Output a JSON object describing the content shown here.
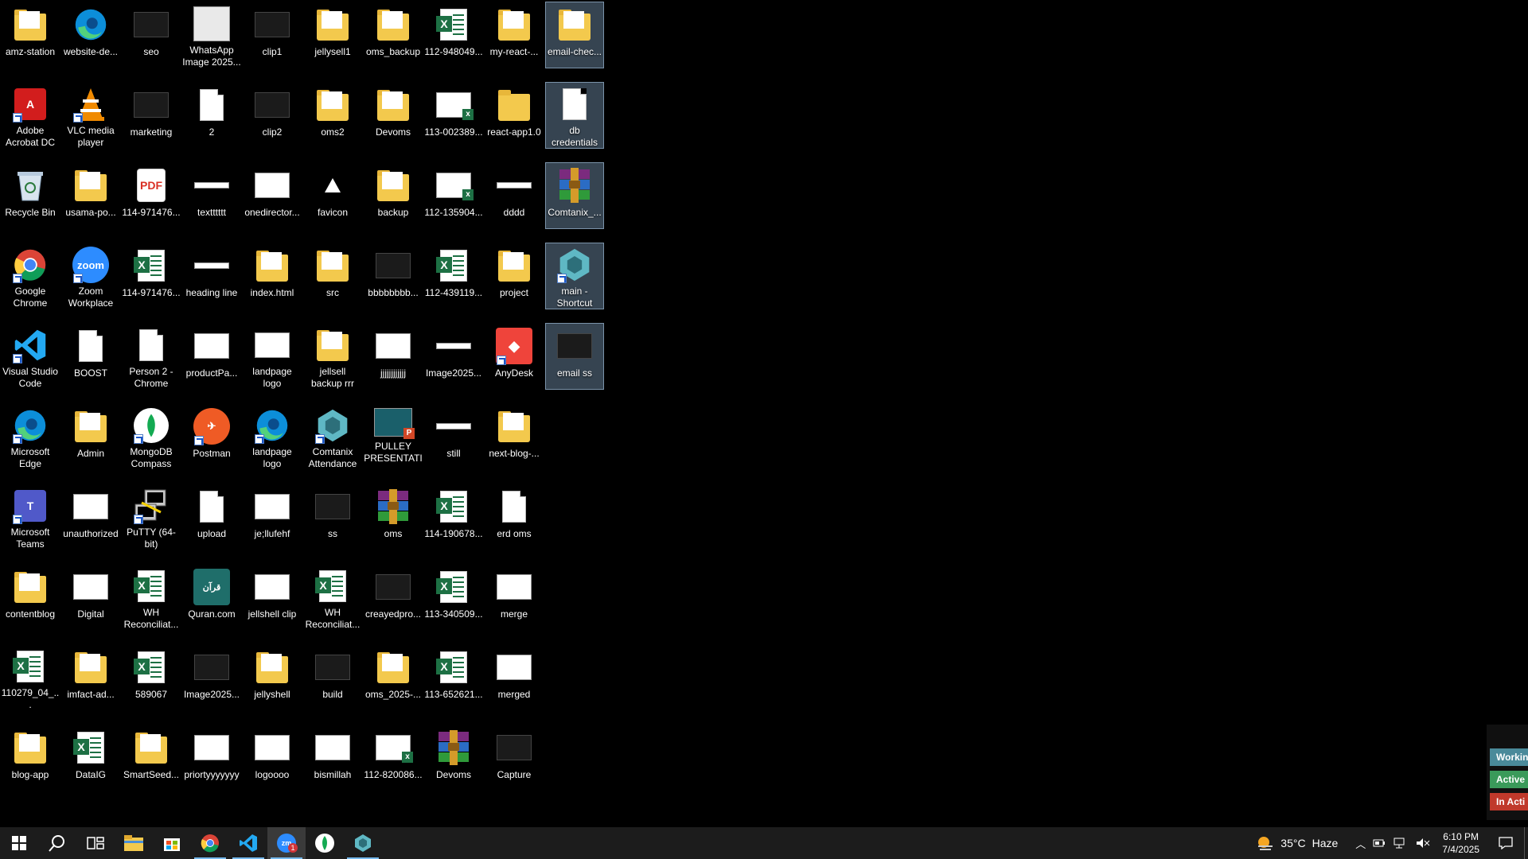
{
  "desktop": {
    "icons": [
      {
        "label": "amz-station",
        "type": "folder"
      },
      {
        "label": "Adobe Acrobat DC",
        "type": "acrobat",
        "shortcut": true
      },
      {
        "label": "Recycle Bin",
        "type": "recycle"
      },
      {
        "label": "Google Chrome",
        "type": "chrome",
        "shortcut": true
      },
      {
        "label": "Visual Studio Code",
        "type": "vscode",
        "shortcut": true
      },
      {
        "label": "Microsoft Edge",
        "type": "edge",
        "shortcut": true
      },
      {
        "label": "Microsoft Teams",
        "type": "teams",
        "shortcut": true
      },
      {
        "label": "contentblog",
        "type": "folder"
      },
      {
        "label": "110279_04_...",
        "type": "excel"
      },
      {
        "label": "blog-app",
        "type": "folder"
      },
      {
        "label": "website-de...",
        "type": "edge"
      },
      {
        "label": "VLC media player",
        "type": "vlc",
        "shortcut": true
      },
      {
        "label": "usama-po...",
        "type": "folder"
      },
      {
        "label": "Zoom Workplace",
        "type": "zoom",
        "shortcut": true
      },
      {
        "label": "BOOST",
        "type": "doc"
      },
      {
        "label": "Admin",
        "type": "folder"
      },
      {
        "label": "unauthorized",
        "type": "thumb"
      },
      {
        "label": "Digital",
        "type": "thumb"
      },
      {
        "label": "imfact-ad...",
        "type": "folder"
      },
      {
        "label": "DataIG",
        "type": "excel"
      },
      {
        "label": "seo",
        "type": "thumb-dark"
      },
      {
        "label": "marketing",
        "type": "thumb-dark"
      },
      {
        "label": "114-971476...",
        "type": "pdf"
      },
      {
        "label": "114-971476...",
        "type": "excel"
      },
      {
        "label": "Person 2 - Chrome",
        "type": "doc"
      },
      {
        "label": "MongoDB Compass",
        "type": "mongo",
        "shortcut": true
      },
      {
        "label": "PuTTY (64-bit)",
        "type": "putty",
        "shortcut": true
      },
      {
        "label": "WH Reconciliat...",
        "type": "excel"
      },
      {
        "label": "589067",
        "type": "excel"
      },
      {
        "label": "SmartSeed...",
        "type": "folder"
      },
      {
        "label": "WhatsApp Image 2025...",
        "type": "thumb-gray"
      },
      {
        "label": "2",
        "type": "doc"
      },
      {
        "label": "textttttt",
        "type": "bar"
      },
      {
        "label": "heading line",
        "type": "bar"
      },
      {
        "label": "productPa...",
        "type": "thumb"
      },
      {
        "label": "Postman",
        "type": "postman",
        "shortcut": true
      },
      {
        "label": "upload",
        "type": "doc"
      },
      {
        "label": "Quran.com",
        "type": "quran"
      },
      {
        "label": "Image2025...",
        "type": "thumb-dark"
      },
      {
        "label": "priortyyyyyyy",
        "type": "thumb"
      },
      {
        "label": "clip1",
        "type": "thumb-dark"
      },
      {
        "label": "clip2",
        "type": "thumb-dark"
      },
      {
        "label": "onedirector...",
        "type": "thumb"
      },
      {
        "label": "index.html",
        "type": "folder"
      },
      {
        "label": "landpage logo",
        "type": "thumb"
      },
      {
        "label": "landpage logo",
        "type": "edge",
        "shortcut": true
      },
      {
        "label": "je;llufehf",
        "type": "thumb"
      },
      {
        "label": "jellshell clip",
        "type": "thumb"
      },
      {
        "label": "jellyshell",
        "type": "folder"
      },
      {
        "label": "logoooo",
        "type": "thumb"
      },
      {
        "label": "jellysell1",
        "type": "folder"
      },
      {
        "label": "oms2",
        "type": "folder"
      },
      {
        "label": "favicon",
        "type": "triangle"
      },
      {
        "label": "src",
        "type": "folder"
      },
      {
        "label": "jellsell backup rrr",
        "type": "folder"
      },
      {
        "label": "Comtanix Attendance",
        "type": "comtanix",
        "shortcut": true
      },
      {
        "label": "ss",
        "type": "thumb-dark"
      },
      {
        "label": "WH Reconciliat...",
        "type": "excel"
      },
      {
        "label": "build",
        "type": "thumb-dark"
      },
      {
        "label": "bismillah",
        "type": "thumb"
      },
      {
        "label": "oms_backup",
        "type": "folder"
      },
      {
        "label": "Devoms",
        "type": "folder"
      },
      {
        "label": "backup",
        "type": "folder"
      },
      {
        "label": "bbbbbbbb...",
        "type": "thumb-dark"
      },
      {
        "label": "jjjjjjjjjjjj",
        "type": "thumb"
      },
      {
        "label": "PULLEY PRESENTATI...",
        "type": "ppt"
      },
      {
        "label": "oms",
        "type": "winrar"
      },
      {
        "label": "creayedpro...",
        "type": "thumb-dark"
      },
      {
        "label": "oms_2025-...",
        "type": "folder"
      },
      {
        "label": "112-820086...",
        "type": "excel-thumb"
      },
      {
        "label": "112-948049...",
        "type": "excel"
      },
      {
        "label": "113-002389...",
        "type": "excel-thumb"
      },
      {
        "label": "112-135904...",
        "type": "excel-thumb"
      },
      {
        "label": "112-439119...",
        "type": "excel"
      },
      {
        "label": "Image2025...",
        "type": "bar"
      },
      {
        "label": "still",
        "type": "bar"
      },
      {
        "label": "114-190678...",
        "type": "excel"
      },
      {
        "label": "113-340509...",
        "type": "excel"
      },
      {
        "label": "113-652621...",
        "type": "excel"
      },
      {
        "label": "Devoms",
        "type": "winrar"
      },
      {
        "label": "my-react-...",
        "type": "folder"
      },
      {
        "label": "react-app1.0",
        "type": "folder-plain"
      },
      {
        "label": "dddd",
        "type": "bar"
      },
      {
        "label": "project",
        "type": "folder"
      },
      {
        "label": "AnyDesk",
        "type": "anydesk",
        "shortcut": true
      },
      {
        "label": "next-blog-...",
        "type": "folder"
      },
      {
        "label": "erd oms",
        "type": "doc"
      },
      {
        "label": "merge",
        "type": "thumb"
      },
      {
        "label": "merged",
        "type": "thumb"
      },
      {
        "label": "Capture",
        "type": "thumb-dark"
      },
      {
        "label": "email-chec...",
        "type": "folder",
        "selected": true
      },
      {
        "label": "db credentials",
        "type": "doc",
        "selected": true
      },
      {
        "label": "Comtanix_...",
        "type": "winrar",
        "selected": true
      },
      {
        "label": "main - Shortcut",
        "type": "comtanix",
        "shortcut": true,
        "selected": true
      },
      {
        "label": "email ss",
        "type": "thumb-dark",
        "selected": true
      }
    ]
  },
  "side_panel": {
    "working": "Workin",
    "active": "Active",
    "inactive": "In Acti"
  },
  "taskbar": {
    "weather_temp": "35°C",
    "weather_desc": "Haze",
    "time": "6:10 PM",
    "date": "7/4/2025",
    "zoom_badge": "1"
  },
  "colors": {
    "folder": "#f3c94d",
    "excel": "#1d7044",
    "working": "#4a8a9a",
    "active": "#3a9a5a",
    "inactive": "#c0392b",
    "taskbar_accent": "#76b9ed"
  }
}
